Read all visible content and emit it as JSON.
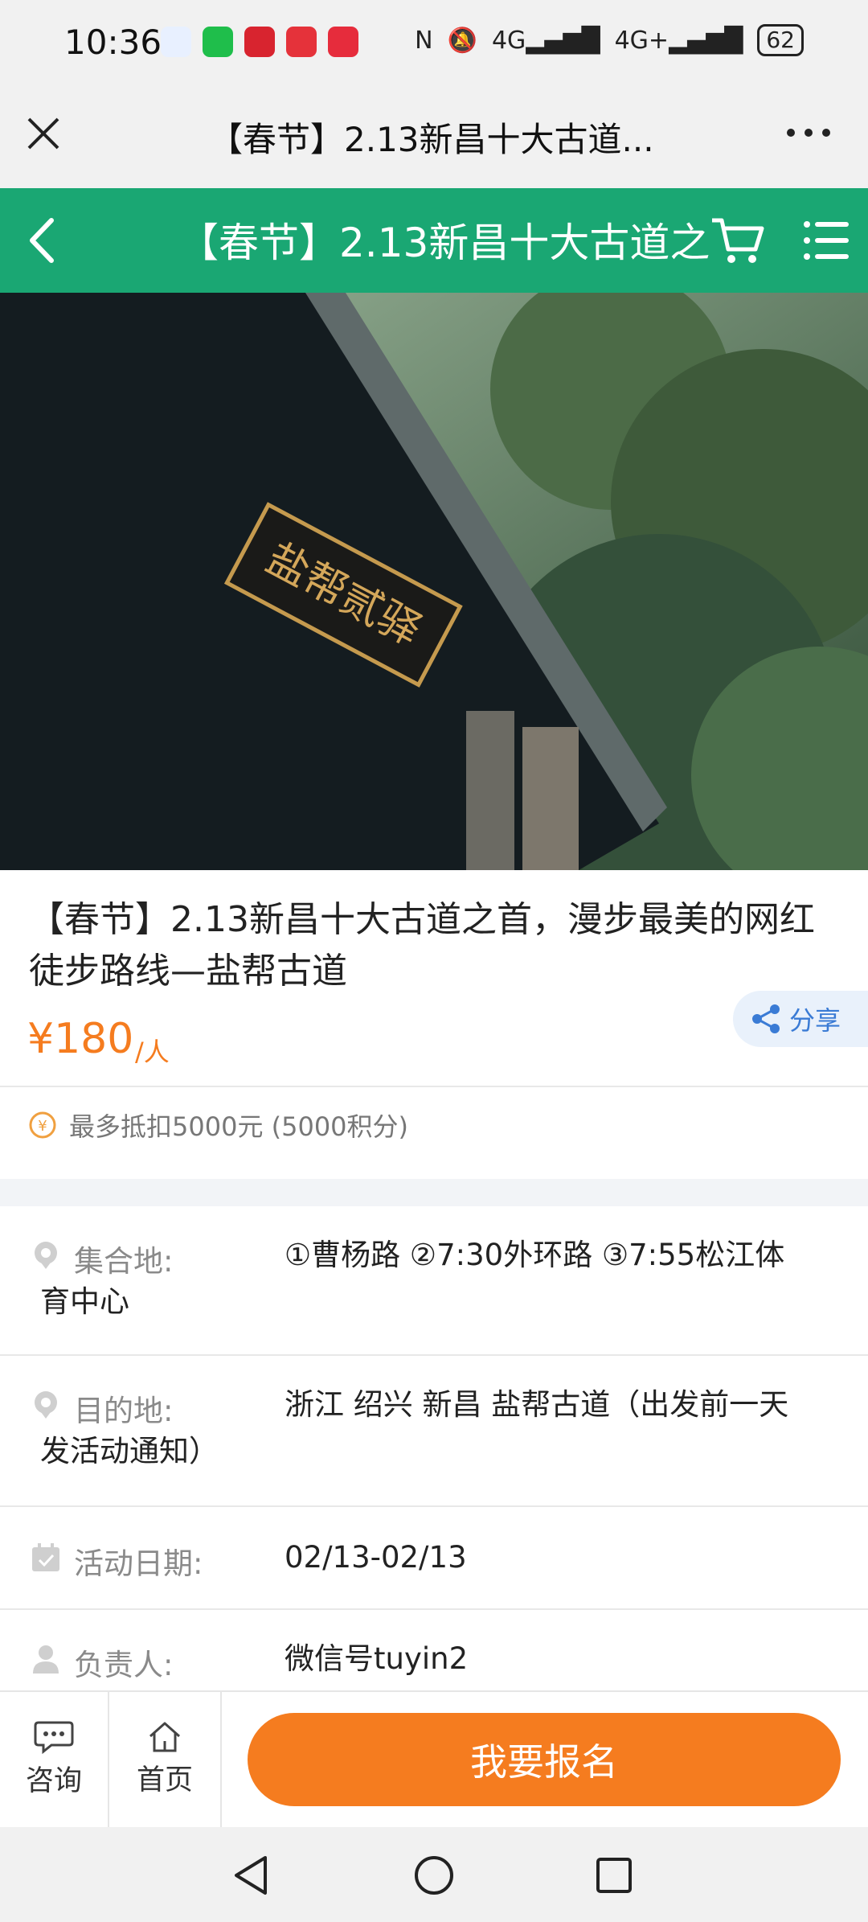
{
  "status_bar": {
    "time": "10:36",
    "battery": "62",
    "signal_1": "4G",
    "signal_2": "4G+"
  },
  "browser": {
    "title": "【春节】2.13新昌十大古道...",
    "close_icon": "close-icon",
    "more_icon": "more-dots-icon"
  },
  "app_header": {
    "title": "【春节】2.13新昌十大古道之",
    "color": "#1aa773"
  },
  "hero": {
    "sign_text": "盐帮贰驿"
  },
  "event": {
    "title": "【春节】2.13新昌十大古道之首，漫步最美的网红徒步路线—盐帮古道",
    "price": "¥180",
    "price_unit": "/人",
    "share_label": "分享",
    "points_text": "最多抵扣5000元 (5000积分)",
    "accent_color": "#f57c1f"
  },
  "info": {
    "meeting": {
      "label": "集合地:",
      "value_line1": "①曹杨路 ②7:30外环路 ③7:55松江体",
      "value_line2": "育中心"
    },
    "destination": {
      "label": "目的地:",
      "value_line1": "浙江 绍兴 新昌 盐帮古道（出发前一天",
      "value_line2": "发活动通知）"
    },
    "date": {
      "label": "活动日期:",
      "value": "02/13-02/13"
    },
    "organizer": {
      "label": "负责人:",
      "value": "微信号tuyin2"
    }
  },
  "bottom_bar": {
    "consult_label": "咨询",
    "home_label": "首页",
    "signup_label": "我要报名"
  }
}
